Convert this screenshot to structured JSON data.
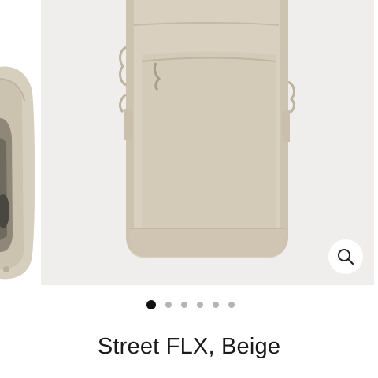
{
  "product": {
    "title": "Street FLX, Beige",
    "color": "#d9d0bf"
  },
  "gallery": {
    "slide_count": 6,
    "active_index": 0,
    "zoom_icon": "magnifier-icon"
  },
  "colors": {
    "dot_active": "#111111",
    "dot_inactive": "#b4b4b4",
    "image_background": "#efeeec"
  }
}
